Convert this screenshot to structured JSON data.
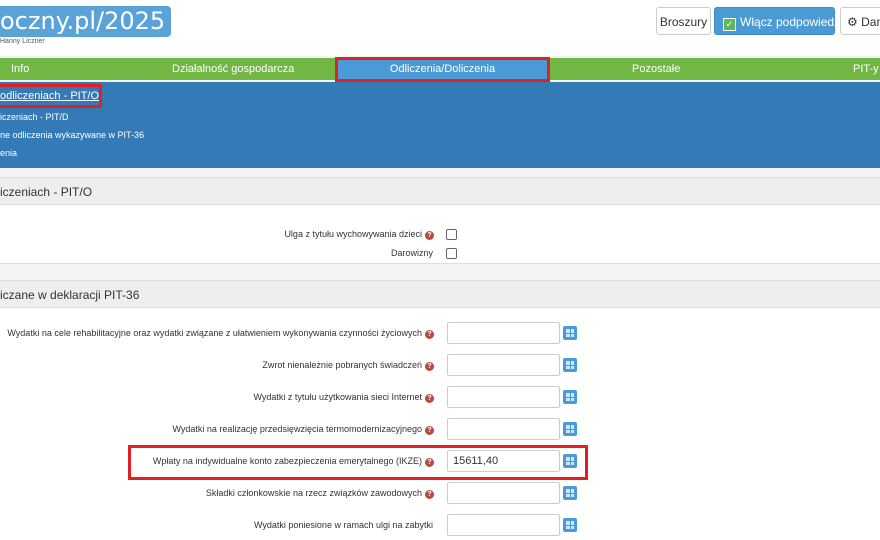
{
  "header": {
    "logo_text": "oczny.pl/2025",
    "author": "Hanny Liczner",
    "buttons": {
      "broszury": "Broszury",
      "hints": "Włącz podpowiedzi",
      "dane": "Dan"
    }
  },
  "nav": {
    "tabs": [
      "Info",
      "Działalność gospodarcza",
      "Odliczenia/Doliczenia",
      "Pozostałe",
      "PIT-y"
    ],
    "active_index": 2
  },
  "subnav": {
    "items": [
      "odliczeniach - PIT/O",
      "iczeniach - PIT/D",
      "ne odliczenia wykazywane w PIT-36",
      "enia"
    ]
  },
  "sections": {
    "pito_title": "iczeniach - PIT/O",
    "pit36_title": "iczane w deklaracji PIT-36"
  },
  "pito_rows": [
    {
      "label": "Ulga z tytułu wychowywania dzieci",
      "help": true
    },
    {
      "label": "Darowizny",
      "help": false
    }
  ],
  "pit36_rows": [
    {
      "label": "Wydatki na cele rehabilitacyjne oraz wydatki związane z ułatwieniem wykonywania czynności życiowych",
      "help": true,
      "value": ""
    },
    {
      "label": "Zwrot nienależnie pobranych świadczeń",
      "help": true,
      "value": ""
    },
    {
      "label": "Wydatki z tytułu użytkowania sieci Internet",
      "help": true,
      "value": ""
    },
    {
      "label": "Wydatki na realizację przedsięwzięcia termomodernizacyjnego",
      "help": true,
      "value": ""
    },
    {
      "label": "Wpłaty na indywidualne konto zabezpieczenia emerytalnego (IKZE)",
      "help": true,
      "value": "15611,40"
    },
    {
      "label": "Składki członkowskie na rzecz związków zawodowych",
      "help": true,
      "value": ""
    },
    {
      "label": "Wydatki poniesione w ramach ulgi na zabytki",
      "help": false,
      "value": ""
    }
  ],
  "colors": {
    "nav_green": "#70b743",
    "active_blue": "#4a9bd5",
    "panel_blue": "#337ab7",
    "highlight_red": "#e31f26"
  }
}
